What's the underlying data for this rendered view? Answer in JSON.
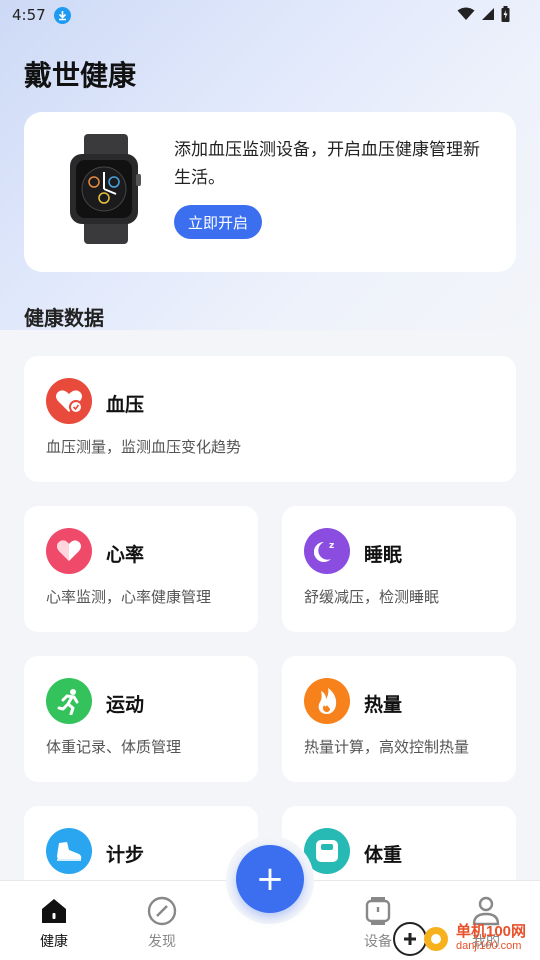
{
  "status_bar": {
    "time": "4:57"
  },
  "app": {
    "title": "戴世健康"
  },
  "promo": {
    "text": "添加血压监测设备，开启血压健康管理新生活。",
    "button_label": "立即开启"
  },
  "section": {
    "title": "健康数据"
  },
  "cards": {
    "blood_pressure": {
      "title": "血压",
      "desc": "血压测量，监测血压变化趋势",
      "icon_color": "#e84a3c"
    },
    "heart_rate": {
      "title": "心率",
      "desc": "心率监测，心率健康管理",
      "icon_color": "#f04a6a"
    },
    "sleep": {
      "title": "睡眠",
      "desc": "舒缓减压，检测睡眠",
      "icon_color": "#8a4de0"
    },
    "exercise": {
      "title": "运动",
      "desc": "体重记录、体质管理",
      "icon_color": "#33c25c"
    },
    "calories": {
      "title": "热量",
      "desc": "热量计算，高效控制热量",
      "icon_color": "#f7821c"
    },
    "steps": {
      "title": "计步",
      "desc": "",
      "icon_color": "#2aa6f0"
    },
    "weight": {
      "title": "体重",
      "desc": "",
      "icon_color": "#27b9b4"
    }
  },
  "bottom_nav": {
    "items": [
      {
        "label": "健康",
        "icon": "home-icon",
        "active": true
      },
      {
        "label": "发现",
        "icon": "compass-icon",
        "active": false
      },
      {
        "label": "设备",
        "icon": "watch-icon",
        "active": false
      },
      {
        "label": "我的",
        "icon": "user-icon",
        "active": false
      }
    ],
    "fab_label": "+"
  },
  "watermark": {
    "text": "单机100网",
    "sub": "danji100.com"
  },
  "colors": {
    "accent": "#3b6ff0"
  }
}
